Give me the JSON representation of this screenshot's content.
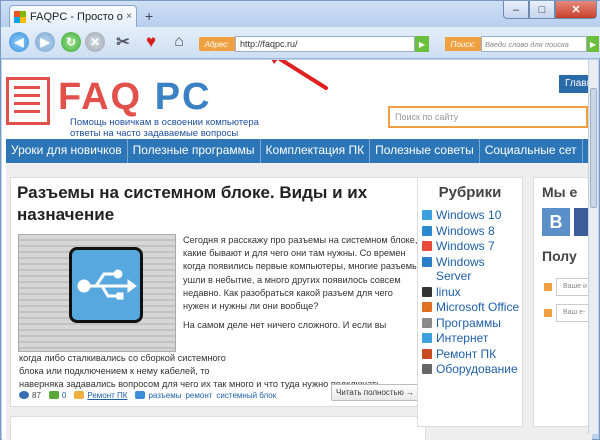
{
  "tab": {
    "title": "FAQPC - Просто о сложн...",
    "close": "×",
    "new_tab": "+"
  },
  "window": {
    "minimize": "–",
    "maximize": "□",
    "close": "✕"
  },
  "toolbar": {
    "address_label": "Адрес:",
    "address_value": "http://faqpc.ru/",
    "search_label": "Поиск:",
    "search_placeholder": "Введи слово для поиска"
  },
  "site": {
    "logo_faq": "FAQ ",
    "logo_pc": "PC",
    "tagline_line1": "Помощь новичкам в освоении компьютера",
    "tagline_line2": "ответы на часто задаваемые вопросы",
    "main_button": "Глави",
    "search_placeholder": "Поиск по сайту"
  },
  "nav": [
    "Уроки для новичков",
    "Полезные программы",
    "Комплектация ПК",
    "Полезные советы",
    "Социальные сет"
  ],
  "article": {
    "title": "Разъемы на системном блоке. Виды и их назначение",
    "para1": "Сегодня я расскажу про разъемы на системном блоке, какие бывают и для чего они там нужны. Со времен когда появились первые компьютеры, многие разъемы ушли в небытие, а много других появилось совсем недавно. Как разобраться какой разъем для чего нужен и нужны ли они вообще?",
    "para2a": "На самом деле нет ничего сложного. И если вы",
    "para2b": "когда либо сталкивались со сборкой системного",
    "para2c": "блока или подключением к нему кабелей, то",
    "para2d": "наверняка задавались вопросом для чего их так много и что туда нужно подключать.",
    "views": "87",
    "comments": "0",
    "category": "Ремонт ПК",
    "tags": [
      "разъемы",
      "ремонт",
      "системный блок"
    ],
    "read_more": "Читать полностью →"
  },
  "rubrics": {
    "title": "Рубрики",
    "items": [
      {
        "label": "Windows 10",
        "color": "#3aa0e0"
      },
      {
        "label": "Windows 8",
        "color": "#2a8ad0"
      },
      {
        "label": "Windows 7",
        "color": "#e84b3c"
      },
      {
        "label": "Windows Server",
        "color": "#2a7fc8"
      },
      {
        "label": "linux",
        "color": "#333333"
      },
      {
        "label": "Microsoft Office",
        "color": "#e07020"
      },
      {
        "label": "Программы",
        "color": "#8a8a8a"
      },
      {
        "label": "Интернет",
        "color": "#3aa0e0"
      },
      {
        "label": "Ремонт ПК",
        "color": "#c84a20"
      },
      {
        "label": "Оборудование",
        "color": "#666666"
      }
    ]
  },
  "right": {
    "we_title": "Мы е",
    "vk": "В",
    "subscribe_title": "Полу",
    "field1": "Ваше и",
    "field2": "Ваш e-"
  }
}
